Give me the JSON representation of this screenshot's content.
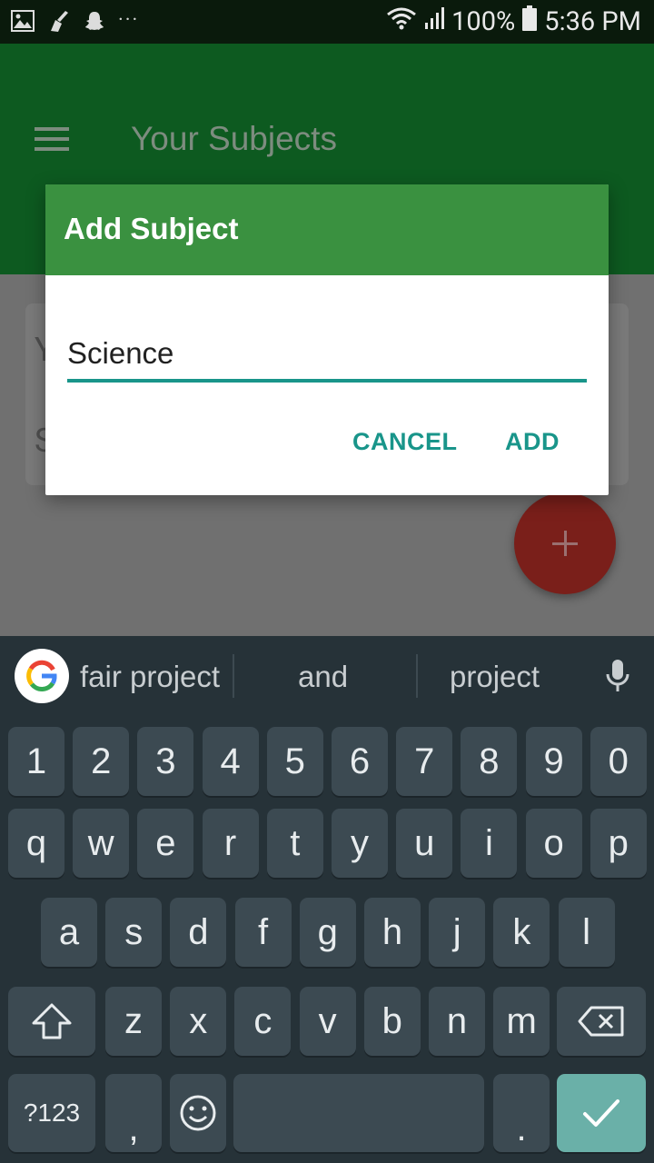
{
  "status_bar": {
    "icons_left": [
      "image-icon",
      "cleaner-icon",
      "snapchat-icon"
    ],
    "more": "···",
    "battery": "100%",
    "time": "5:36 PM"
  },
  "app": {
    "title": "Your Subjects",
    "background_hint_1": "Y",
    "background_hint_2": "S",
    "colors": {
      "app_bar": "#0d5a20",
      "fab": "#7a1f1a"
    }
  },
  "dialog": {
    "title": "Add Subject",
    "input_value": "Science",
    "cancel_label": "CANCEL",
    "add_label": "ADD",
    "colors": {
      "header": "#3a9140",
      "accent": "#19958a"
    }
  },
  "keyboard": {
    "suggestions": [
      "fair project",
      "and",
      "project"
    ],
    "row_numbers": [
      "1",
      "2",
      "3",
      "4",
      "5",
      "6",
      "7",
      "8",
      "9",
      "0"
    ],
    "row_1": [
      "q",
      "w",
      "e",
      "r",
      "t",
      "y",
      "u",
      "i",
      "o",
      "p"
    ],
    "row_2": [
      "a",
      "s",
      "d",
      "f",
      "g",
      "h",
      "j",
      "k",
      "l"
    ],
    "row_3": [
      "z",
      "x",
      "c",
      "v",
      "b",
      "n",
      "m"
    ],
    "symbols_label": "?123",
    "comma": ",",
    "period": ".",
    "colors": {
      "background": "#263238",
      "key": "#3c4a52",
      "enter": "#6ab0a8"
    }
  }
}
